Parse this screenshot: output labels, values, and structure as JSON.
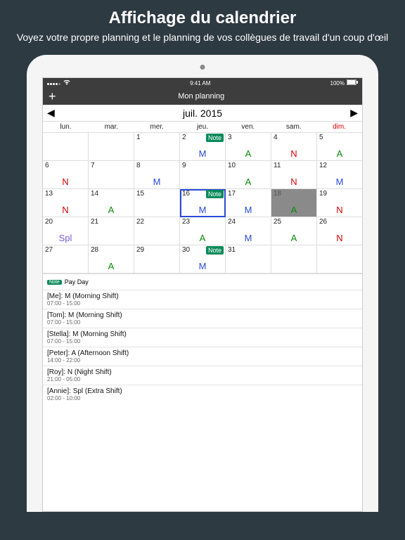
{
  "promo": {
    "title": "Affichage du calendrier",
    "subtitle": "Voyez votre propre planning et le planning de vos collègues de travail d'un coup d'œil"
  },
  "statusbar": {
    "time": "9:41 AM",
    "battery": "100%"
  },
  "navbar": {
    "add": "+",
    "title": "Mon planning"
  },
  "month": {
    "label": "juil. 2015",
    "prev": "◀",
    "next": "▶"
  },
  "dow": [
    "lun.",
    "mar.",
    "mer.",
    "jeu.",
    "ven.",
    "sam.",
    "dim."
  ],
  "weeks": [
    [
      {
        "n": ""
      },
      {
        "n": ""
      },
      {
        "n": "1"
      },
      {
        "n": "2",
        "note": "Note",
        "shift": "M",
        "cls": "c-blue"
      },
      {
        "n": "3",
        "shift": "A",
        "cls": "c-green"
      },
      {
        "n": "4",
        "shift": "N",
        "cls": "c-red"
      },
      {
        "n": "5",
        "shift": "A",
        "cls": "c-green"
      }
    ],
    [
      {
        "n": "6",
        "shift": "N",
        "cls": "c-red"
      },
      {
        "n": "7"
      },
      {
        "n": "8",
        "shift": "M",
        "cls": "c-blue"
      },
      {
        "n": "9"
      },
      {
        "n": "10",
        "shift": "A",
        "cls": "c-green"
      },
      {
        "n": "11",
        "shift": "N",
        "cls": "c-red"
      },
      {
        "n": "12",
        "shift": "M",
        "cls": "c-blue"
      }
    ],
    [
      {
        "n": "13",
        "shift": "N",
        "cls": "c-red"
      },
      {
        "n": "14",
        "shift": "A",
        "cls": "c-green"
      },
      {
        "n": "15"
      },
      {
        "n": "16",
        "note": "Note",
        "shift": "M",
        "cls": "c-blue",
        "today": true
      },
      {
        "n": "17",
        "shift": "M",
        "cls": "c-blue"
      },
      {
        "n": "18",
        "shift": "A",
        "cls": "c-green",
        "gray": true
      },
      {
        "n": "19",
        "shift": "N",
        "cls": "c-red"
      }
    ],
    [
      {
        "n": "20",
        "shift": "Spl",
        "cls": "c-purple"
      },
      {
        "n": "21"
      },
      {
        "n": "22"
      },
      {
        "n": "23",
        "shift": "A",
        "cls": "c-green"
      },
      {
        "n": "24",
        "shift": "M",
        "cls": "c-blue"
      },
      {
        "n": "25",
        "shift": "A",
        "cls": "c-green"
      },
      {
        "n": "26",
        "shift": "N",
        "cls": "c-red"
      }
    ],
    [
      {
        "n": "27"
      },
      {
        "n": "28",
        "shift": "A",
        "cls": "c-green"
      },
      {
        "n": "29"
      },
      {
        "n": "30",
        "note": "Note",
        "shift": "M",
        "cls": "c-blue"
      },
      {
        "n": "31"
      },
      {
        "n": ""
      },
      {
        "n": ""
      }
    ]
  ],
  "note_row": {
    "badge": "Note",
    "text": "Pay Day"
  },
  "schedule": [
    {
      "title": "[Me]: M (Morning Shift)",
      "time": "07:00 - 15:00"
    },
    {
      "title": "[Tom]: M (Morning Shift)",
      "time": "07:00 - 15:00"
    },
    {
      "title": "[Stella]: M (Morning Shift)",
      "time": "07:00 - 15:00"
    },
    {
      "title": "[Peter]: A (Afternoon Shift)",
      "time": "14:00 - 22:00"
    },
    {
      "title": "[Roy]: N (Night Shift)",
      "time": "21:00 - 05:00"
    },
    {
      "title": "[Annie]: Spl (Extra Shift)",
      "time": "02:00 - 10:00"
    }
  ]
}
